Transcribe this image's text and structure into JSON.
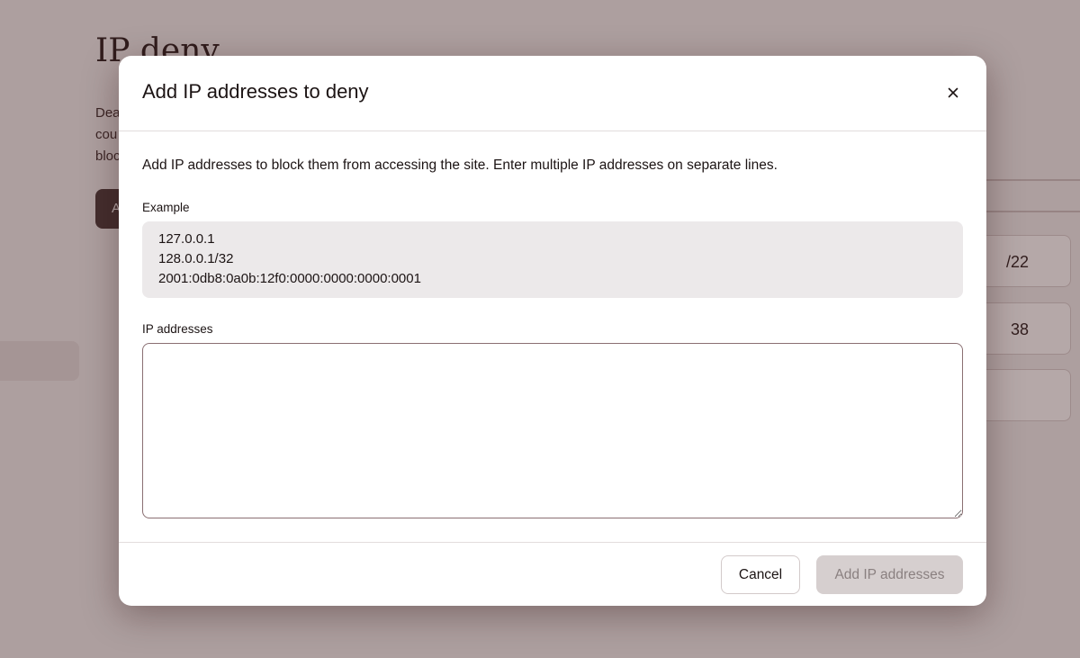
{
  "background": {
    "page_title": "IP deny",
    "description_fragments": [
      "Dea",
      "cou",
      "bloc"
    ],
    "button_fragment": "A",
    "card_values": [
      "/22",
      "38"
    ]
  },
  "modal": {
    "title": "Add IP addresses to deny",
    "close_icon": "close-icon",
    "description": "Add IP addresses to block them from accessing the site. Enter multiple IP addresses on separate lines.",
    "example": {
      "label": "Example",
      "lines": [
        "127.0.0.1",
        "128.0.0.1/32",
        "2001:0db8:0a0b:12f0:0000:0000:0000:0001"
      ]
    },
    "ip_field": {
      "label": "IP addresses",
      "value": ""
    },
    "footer": {
      "cancel_label": "Cancel",
      "submit_label": "Add IP addresses",
      "submit_disabled": true
    }
  },
  "colors": {
    "overlay": "#5a2828",
    "primary_dark": "#4a3a3a",
    "disabled_button": "#d6cfcf",
    "example_bg": "#ece9ea"
  }
}
